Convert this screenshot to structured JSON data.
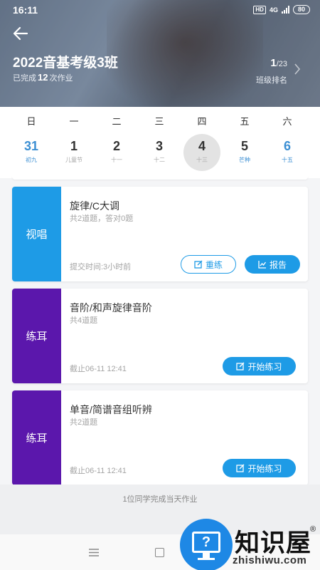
{
  "status_bar": {
    "time": "16:11",
    "hd": "HD",
    "network": "4G",
    "battery": "80"
  },
  "header": {
    "title": "2022音基考级3班",
    "done_prefix": "已完成",
    "done_count": "12",
    "done_suffix": "次作业",
    "rank_current": "1",
    "rank_total": "/23",
    "rank_label": "班级排名"
  },
  "calendar": {
    "weekdays": [
      "日",
      "一",
      "二",
      "三",
      "四",
      "五",
      "六"
    ],
    "dates": [
      {
        "num": "31",
        "sub": "初九"
      },
      {
        "num": "1",
        "sub": "儿童节"
      },
      {
        "num": "2",
        "sub": "十一"
      },
      {
        "num": "3",
        "sub": "十二"
      },
      {
        "num": "4",
        "sub": "十三"
      },
      {
        "num": "5",
        "sub": "芒种"
      },
      {
        "num": "6",
        "sub": "十五"
      }
    ],
    "selected_index": 4
  },
  "assignments": [
    {
      "tag": "视唱",
      "title": "旋律/C大调",
      "subtitle": "共2道题，答对0题",
      "meta": "提交时间:3小时前",
      "retry_label": "重练",
      "report_label": "报告"
    },
    {
      "tag": "练耳",
      "title": "音阶/和声旋律音阶",
      "subtitle": "共4道题",
      "meta": "截止06-11 12:41",
      "start_label": "开始练习"
    },
    {
      "tag": "练耳",
      "title": "单音/简谱音组听辨",
      "subtitle": "共2道题",
      "meta": "截止06-11 12:41",
      "start_label": "开始练习"
    }
  ],
  "footer": {
    "note": "1位同学完成当天作业"
  },
  "watermark": {
    "title": "知识屋",
    "registered": "®",
    "url": "zhishiwu.com",
    "logo_mark": "?"
  },
  "colors": {
    "accent_blue": "#1e9be6",
    "tag_purple": "#5b17ac",
    "date_blue": "#3c8fd3"
  }
}
